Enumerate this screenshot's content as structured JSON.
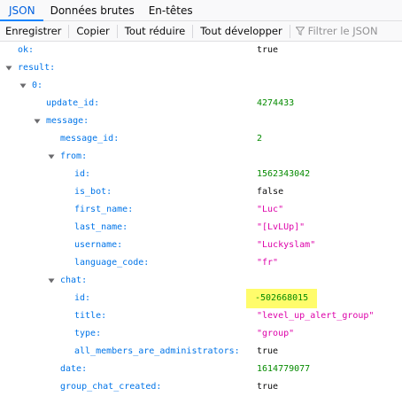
{
  "tabs": [
    {
      "label": "JSON",
      "active": true
    },
    {
      "label": "Données brutes",
      "active": false
    },
    {
      "label": "En-têtes",
      "active": false
    }
  ],
  "toolbar": {
    "save": "Enregistrer",
    "copy": "Copier",
    "collapse_all": "Tout réduire",
    "expand_all": "Tout développer",
    "filter_placeholder": "Filtrer le JSON"
  },
  "colors": {
    "key": "#0074e8",
    "number": "#058b00",
    "string": "#dd00a9",
    "highlight": "#fffc6b",
    "active_tab": "#0a84ff"
  },
  "rows": [
    {
      "key": "ok:",
      "value": "true",
      "type": "bool",
      "expanded": null
    },
    {
      "key": "result:",
      "value": "",
      "type": "",
      "expanded": true
    },
    {
      "key": "0:",
      "value": "",
      "type": "",
      "expanded": true
    },
    {
      "key": "update_id:",
      "value": "4274433",
      "type": "num",
      "expanded": null
    },
    {
      "key": "message:",
      "value": "",
      "type": "",
      "expanded": true
    },
    {
      "key": "message_id:",
      "value": "2",
      "type": "num",
      "expanded": null
    },
    {
      "key": "from:",
      "value": "",
      "type": "",
      "expanded": true
    },
    {
      "key": "id:",
      "value": "1562343042",
      "type": "num",
      "expanded": null
    },
    {
      "key": "is_bot:",
      "value": "false",
      "type": "bool",
      "expanded": null
    },
    {
      "key": "first_name:",
      "value": "\"Luc\"",
      "type": "str",
      "expanded": null
    },
    {
      "key": "last_name:",
      "value": "\"[LvLUp]\"",
      "type": "str",
      "expanded": null
    },
    {
      "key": "username:",
      "value": "\"Luckyslam\"",
      "type": "str",
      "expanded": null
    },
    {
      "key": "language_code:",
      "value": "\"fr\"",
      "type": "str",
      "expanded": null
    },
    {
      "key": "chat:",
      "value": "",
      "type": "",
      "expanded": true
    },
    {
      "key": "id:",
      "value": "-502668015",
      "type": "num",
      "expanded": null,
      "highlighted": true
    },
    {
      "key": "title:",
      "value": "\"level_up_alert_group\"",
      "type": "str",
      "expanded": null
    },
    {
      "key": "type:",
      "value": "\"group\"",
      "type": "str",
      "expanded": null
    },
    {
      "key": "all_members_are_administrators:",
      "value": "true",
      "type": "bool",
      "expanded": null
    },
    {
      "key": "date:",
      "value": "1614779077",
      "type": "num",
      "expanded": null
    },
    {
      "key": "group_chat_created:",
      "value": "true",
      "type": "bool",
      "expanded": null
    }
  ]
}
